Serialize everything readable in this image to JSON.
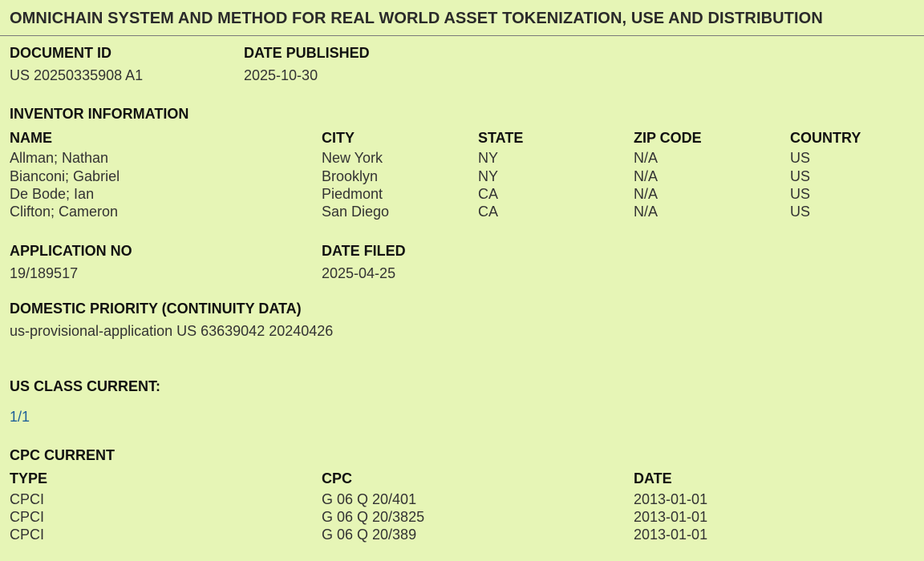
{
  "title": "OMNICHAIN SYSTEM AND METHOD FOR REAL WORLD ASSET TOKENIZATION, USE AND DISTRIBUTION",
  "document_id": {
    "label": "DOCUMENT ID",
    "value": "US 20250335908 A1"
  },
  "date_published": {
    "label": "DATE PUBLISHED",
    "value": "2025-10-30"
  },
  "inventor_info": {
    "heading": "INVENTOR INFORMATION",
    "columns": [
      "NAME",
      "CITY",
      "STATE",
      "ZIP CODE",
      "COUNTRY"
    ],
    "rows": [
      [
        "Allman; Nathan",
        "New York",
        "NY",
        "N/A",
        "US"
      ],
      [
        "Bianconi; Gabriel",
        "Brooklyn",
        "NY",
        "N/A",
        "US"
      ],
      [
        "De Bode; Ian",
        "Piedmont",
        "CA",
        "N/A",
        "US"
      ],
      [
        "Clifton; Cameron",
        "San Diego",
        "CA",
        "N/A",
        "US"
      ]
    ]
  },
  "application_no": {
    "label": "APPLICATION NO",
    "value": "19/189517"
  },
  "date_filed": {
    "label": "DATE FILED",
    "value": "2025-04-25"
  },
  "domestic_priority": {
    "label": "DOMESTIC PRIORITY (CONTINUITY DATA)",
    "value": "us-provisional-application US 63639042 20240426"
  },
  "us_class_current": {
    "label": "US CLASS CURRENT:",
    "value": "1/1"
  },
  "cpc_current": {
    "heading": "CPC CURRENT",
    "columns": [
      "TYPE",
      "CPC",
      "DATE"
    ],
    "rows": [
      [
        "CPCI",
        "G 06 Q 20/401",
        "2013-01-01"
      ],
      [
        "CPCI",
        "G 06 Q 20/3825",
        "2013-01-01"
      ],
      [
        "CPCI",
        "G 06 Q 20/389",
        "2013-01-01"
      ]
    ]
  },
  "colors": {
    "background": "#e6f5b6",
    "link": "#1f6098",
    "rule": "#7a7a7a"
  }
}
